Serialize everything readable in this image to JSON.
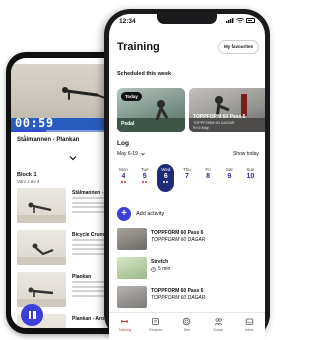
{
  "back_phone": {
    "video": {
      "time": "00:59",
      "progress": 0.3
    },
    "exercise_title": "Stålmannen - Plankan",
    "block": {
      "label": "Block 1",
      "sub": "Varv 1 av 4"
    },
    "exercises": [
      {
        "name": "Stålmannen - Pl"
      },
      {
        "name": "Bicycle Crunch"
      },
      {
        "name": "Plankan"
      },
      {
        "name": "Plankan - Arosp"
      }
    ]
  },
  "front_phone": {
    "status": {
      "time": "12:34"
    },
    "title": "Training",
    "favourites_label": "My favourites",
    "scheduled_label": "Scheduled this week",
    "cards": [
      {
        "badge": "Today",
        "title": "Pedal"
      },
      {
        "title": "TOPPFORM 60 Pass 5",
        "sub": "TOPPFORM 60 DAGAR",
        "sub2": "Fri 6 May"
      }
    ],
    "log": {
      "title": "Log",
      "range": "May 6-19",
      "show_today": "Show today",
      "days": [
        {
          "name": "Mon",
          "date": "4",
          "dots": 2
        },
        {
          "name": "Tue",
          "date": "5",
          "dots": 2
        },
        {
          "name": "Wed",
          "date": "6",
          "dots": 2,
          "selected": true
        },
        {
          "name": "Thu",
          "date": "7",
          "dots": 0
        },
        {
          "name": "Fri",
          "date": "8",
          "dots": 0
        },
        {
          "name": "Sat",
          "date": "9",
          "dots": 0
        },
        {
          "name": "Sun",
          "date": "10",
          "dots": 0
        }
      ]
    },
    "add_activity": "Add activity",
    "activities": [
      {
        "name": "TOPPFORM 60 Pass 6",
        "sub": "TOPPFORM 60 DAGAR"
      },
      {
        "name": "Stretch",
        "sub": "5 min"
      },
      {
        "name": "TOPPFORM 60 Pass 6",
        "sub": "TOPPFORM 60 DAGAR"
      }
    ],
    "tabs": [
      {
        "label": "Training",
        "icon": "dumbbell-icon",
        "active": true
      },
      {
        "label": "Recipes",
        "icon": "book-icon"
      },
      {
        "label": "Diet",
        "icon": "plate-icon"
      },
      {
        "label": "Social",
        "icon": "people-icon"
      },
      {
        "label": "Inbox",
        "icon": "inbox-icon"
      }
    ],
    "accent": "#3b3fd8",
    "selected_day_color": "#1f2a78"
  }
}
